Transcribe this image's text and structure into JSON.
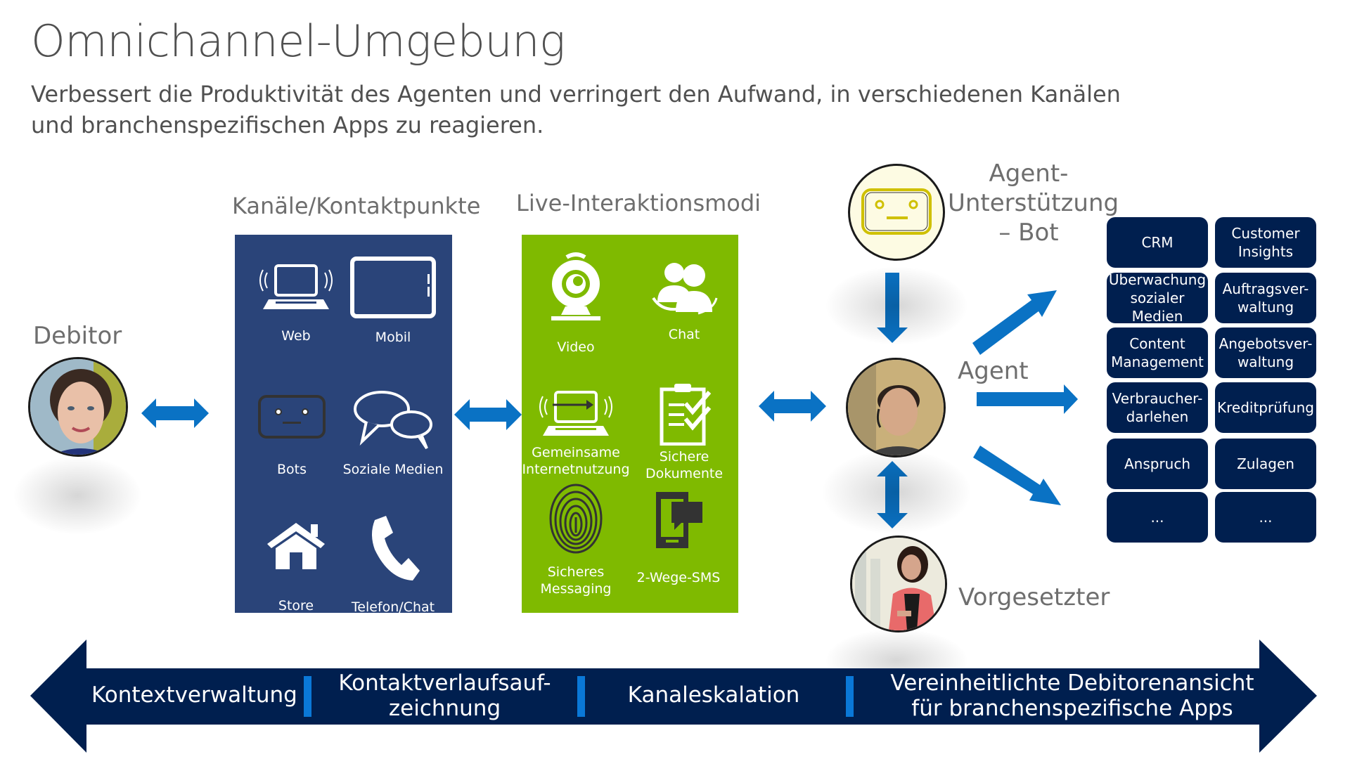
{
  "slide": {
    "title": "Omnichannel-Umgebung",
    "subtitle": "Verbessert die Produktivität des Agenten und verringert den Aufwand, in verschiedenen Kanälen und branchenspezifischen Apps zu reagieren."
  },
  "colors": {
    "channels_panel": "#2a4479",
    "live_panel": "#7fba00",
    "arrow": "#0a72c4",
    "app_tile": "#001f4f",
    "banner": "#001f4f",
    "separator": "#0a78d7"
  },
  "customer": {
    "label": "Debitor",
    "icon": "customer-photo"
  },
  "channels": {
    "heading": "Kanäle/Kontaktpunkte",
    "items": [
      {
        "label": "Web",
        "icon": "laptop-wireless-icon"
      },
      {
        "label": "Mobil",
        "icon": "tablet-icon"
      },
      {
        "label": "Bots",
        "icon": "bot-face-icon"
      },
      {
        "label": "Soziale Medien",
        "icon": "speech-bubbles-icon"
      },
      {
        "label": "Store",
        "icon": "house-icon"
      },
      {
        "label": "Telefon/Chat",
        "icon": "phone-icon"
      }
    ]
  },
  "live_modes": {
    "heading": "Live-Interaktionsmodi",
    "items": [
      {
        "label": "Video",
        "icon": "webcam-icon"
      },
      {
        "label": "Chat",
        "icon": "people-chat-icon"
      },
      {
        "label": "Gemeinsame Internetnutzung",
        "line1": "Gemeinsame",
        "line2": "Internetnutzung",
        "icon": "co-browse-laptop-icon"
      },
      {
        "label": "Sichere Dokumente",
        "line1": "Sichere",
        "line2": "Dokumente",
        "icon": "clipboard-check-icon"
      },
      {
        "label": "Sicheres Messaging",
        "line1": "Sicheres",
        "line2": "Messaging",
        "icon": "fingerprint-icon"
      },
      {
        "label": "2-Wege-SMS",
        "icon": "phone-sms-icon"
      }
    ]
  },
  "bot": {
    "label_line1": "Agent-",
    "label_line2": "Unterstützung",
    "label_line3": "– Bot",
    "icon": "bot-face-icon"
  },
  "agent": {
    "label": "Agent",
    "icon": "agent-photo"
  },
  "supervisor": {
    "label": "Vorgesetzter",
    "icon": "supervisor-photo"
  },
  "apps": [
    {
      "line1": "CRM",
      "line2": ""
    },
    {
      "line1": "Customer",
      "line2": "Insights"
    },
    {
      "line1": "Überwachung",
      "line2": "sozialer Medien"
    },
    {
      "line1": "Auftragsver-",
      "line2": "waltung"
    },
    {
      "line1": "Content",
      "line2": "Management"
    },
    {
      "line1": "Angebotsver-",
      "line2": "waltung"
    },
    {
      "line1": "Verbraucher-",
      "line2": "darlehen"
    },
    {
      "line1": "Kreditprüfung",
      "line2": ""
    },
    {
      "line1": "Anspruch",
      "line2": ""
    },
    {
      "line1": "Zulagen",
      "line2": ""
    },
    {
      "line1": "...",
      "line2": ""
    },
    {
      "line1": "...",
      "line2": ""
    }
  ],
  "banner": {
    "items": [
      {
        "line1": "Kontextverwaltung",
        "line2": ""
      },
      {
        "line1": "Kontaktverlaufsauf-",
        "line2": "zeichnung"
      },
      {
        "line1": "Kanaleskalation",
        "line2": ""
      },
      {
        "line1": "Vereinheitlichte Debitorenansicht",
        "line2": "für branchenspezifische Apps"
      }
    ]
  }
}
